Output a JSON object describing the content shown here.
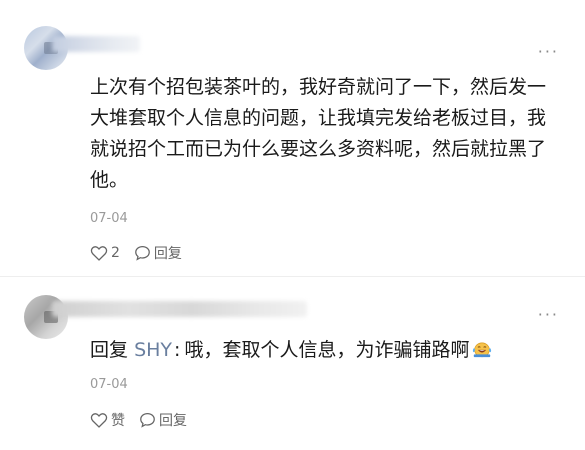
{
  "comments": [
    {
      "more_label": "···",
      "text": "上次有个招包装茶叶的，我好奇就问了一下，然后发一大堆套取个人信息的问题，让我填完发给老板过目，我就说招个工而已为什么要这么多资料呢，然后就拉黑了他。",
      "date": "07-04",
      "like_label": "2",
      "reply_label": "回复"
    },
    {
      "more_label": "···",
      "reply_prefix": "回复",
      "reply_to": "SHY",
      "reply_sep": ":",
      "text": "哦，套取个人信息，为诈骗铺路啊",
      "date": "07-04",
      "like_label": "赞",
      "reply_label": "回复"
    }
  ],
  "colors": {
    "link": "#6a7f9f",
    "meta": "#9a9a9a"
  },
  "icons": {
    "like": "heart-outline-icon",
    "reply": "comment-bubble-icon",
    "emoji": "laughing-tears-emoji-icon"
  }
}
